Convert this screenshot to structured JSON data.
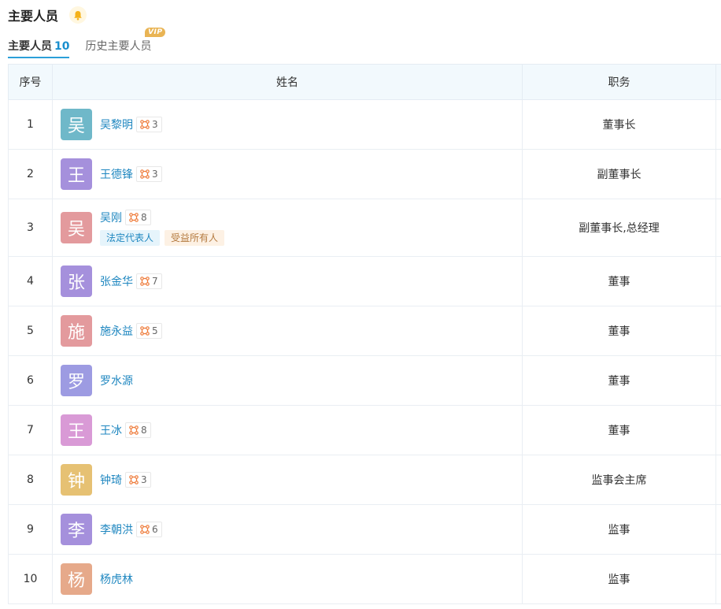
{
  "header": {
    "title": "主要人员"
  },
  "tabs": [
    {
      "label": "主要人员",
      "count": "10"
    },
    {
      "label": "历史主要人员",
      "badge": "VIP"
    }
  ],
  "table": {
    "headers": {
      "index": "序号",
      "name": "姓名",
      "position": "职务"
    },
    "rows": [
      {
        "index": "1",
        "avatar": "吴",
        "avatar_color": "#6fb8c9",
        "name": "吴黎明",
        "relations": "3",
        "position": "董事长"
      },
      {
        "index": "2",
        "avatar": "王",
        "avatar_color": "#a590dc",
        "name": "王德锋",
        "relations": "3",
        "position": "副董事长"
      },
      {
        "index": "3",
        "avatar": "吴",
        "avatar_color": "#e39a9d",
        "name": "吴刚",
        "relations": "8",
        "position": "副董事长,总经理",
        "tags": [
          "法定代表人",
          "受益所有人"
        ]
      },
      {
        "index": "4",
        "avatar": "张",
        "avatar_color": "#a590dc",
        "name": "张金华",
        "relations": "7",
        "position": "董事"
      },
      {
        "index": "5",
        "avatar": "施",
        "avatar_color": "#e39a9d",
        "name": "施永益",
        "relations": "5",
        "position": "董事"
      },
      {
        "index": "6",
        "avatar": "罗",
        "avatar_color": "#9d9be2",
        "name": "罗水源",
        "relations": "",
        "position": "董事"
      },
      {
        "index": "7",
        "avatar": "王",
        "avatar_color": "#d99ad6",
        "name": "王冰",
        "relations": "8",
        "position": "董事"
      },
      {
        "index": "8",
        "avatar": "钟",
        "avatar_color": "#e6c173",
        "name": "钟琦",
        "relations": "3",
        "position": "监事会主席"
      },
      {
        "index": "9",
        "avatar": "李",
        "avatar_color": "#a590dc",
        "name": "李朝洪",
        "relations": "6",
        "position": "监事"
      },
      {
        "index": "10",
        "avatar": "杨",
        "avatar_color": "#e6a98a",
        "name": "杨虎林",
        "relations": "",
        "position": "监事"
      }
    ]
  }
}
